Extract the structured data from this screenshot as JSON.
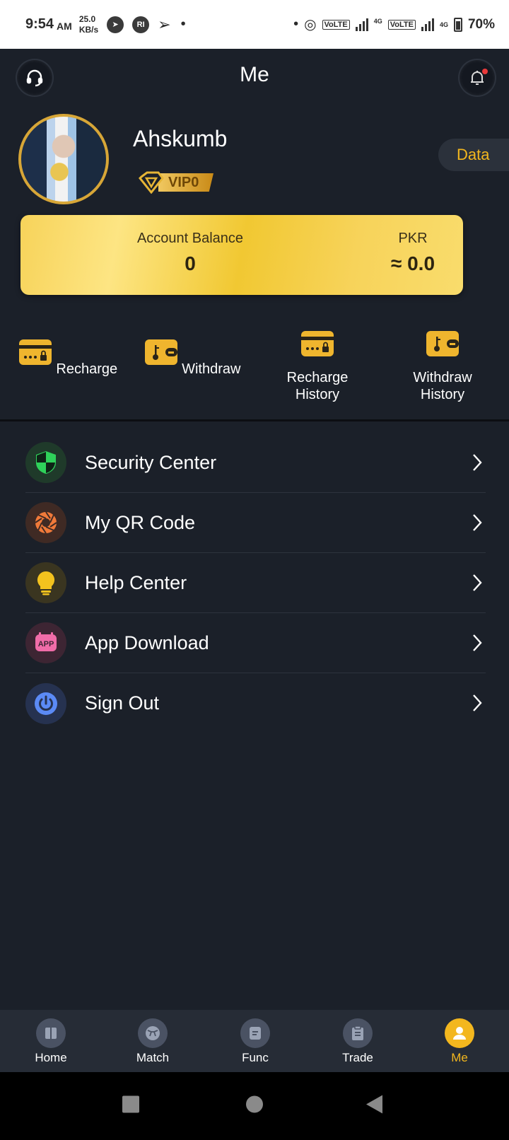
{
  "status_bar": {
    "time": "9:54",
    "ampm": "AM",
    "speed_value": "25.0",
    "speed_unit": "KB/s",
    "app_badge": "RI",
    "volte1": "VoLTE",
    "volte2": "VoLTE",
    "network1": "4G",
    "network2": "4G",
    "battery": "70%"
  },
  "header": {
    "title": "Me",
    "left_icon": "headset-icon",
    "right_icon": "bell-icon"
  },
  "profile": {
    "username": "Ahskumb",
    "vip_label": "VIP0",
    "data_button": "Data"
  },
  "balance": {
    "account_label": "Account Balance",
    "account_value": "0",
    "currency_label": "PKR",
    "currency_value": "≈ 0.0"
  },
  "actions": [
    {
      "label": "Recharge"
    },
    {
      "label": "Withdraw"
    },
    {
      "label": "Recharge History"
    },
    {
      "label": "Withdraw History"
    }
  ],
  "menu": [
    {
      "label": "Security Center",
      "icon": "shield-icon",
      "color": "#2fd15a"
    },
    {
      "label": "My QR Code",
      "icon": "aperture-icon",
      "color": "#f07a3a"
    },
    {
      "label": "Help Center",
      "icon": "lightbulb-icon",
      "color": "#f3c21e"
    },
    {
      "label": "App Download",
      "icon": "app-icon",
      "color": "#f06ca8",
      "icon_text": "APP"
    },
    {
      "label": "Sign Out",
      "icon": "power-icon",
      "color": "#5b8af5"
    }
  ],
  "bottom_nav": [
    {
      "label": "Home",
      "icon": "home-icon"
    },
    {
      "label": "Match",
      "icon": "ball-icon"
    },
    {
      "label": "Func",
      "icon": "func-icon"
    },
    {
      "label": "Trade",
      "icon": "clipboard-icon"
    },
    {
      "label": "Me",
      "icon": "user-icon",
      "active": true
    }
  ],
  "colors": {
    "background": "#1b2029",
    "accent": "#f3b71e",
    "card_gold": "#f7d35a"
  }
}
